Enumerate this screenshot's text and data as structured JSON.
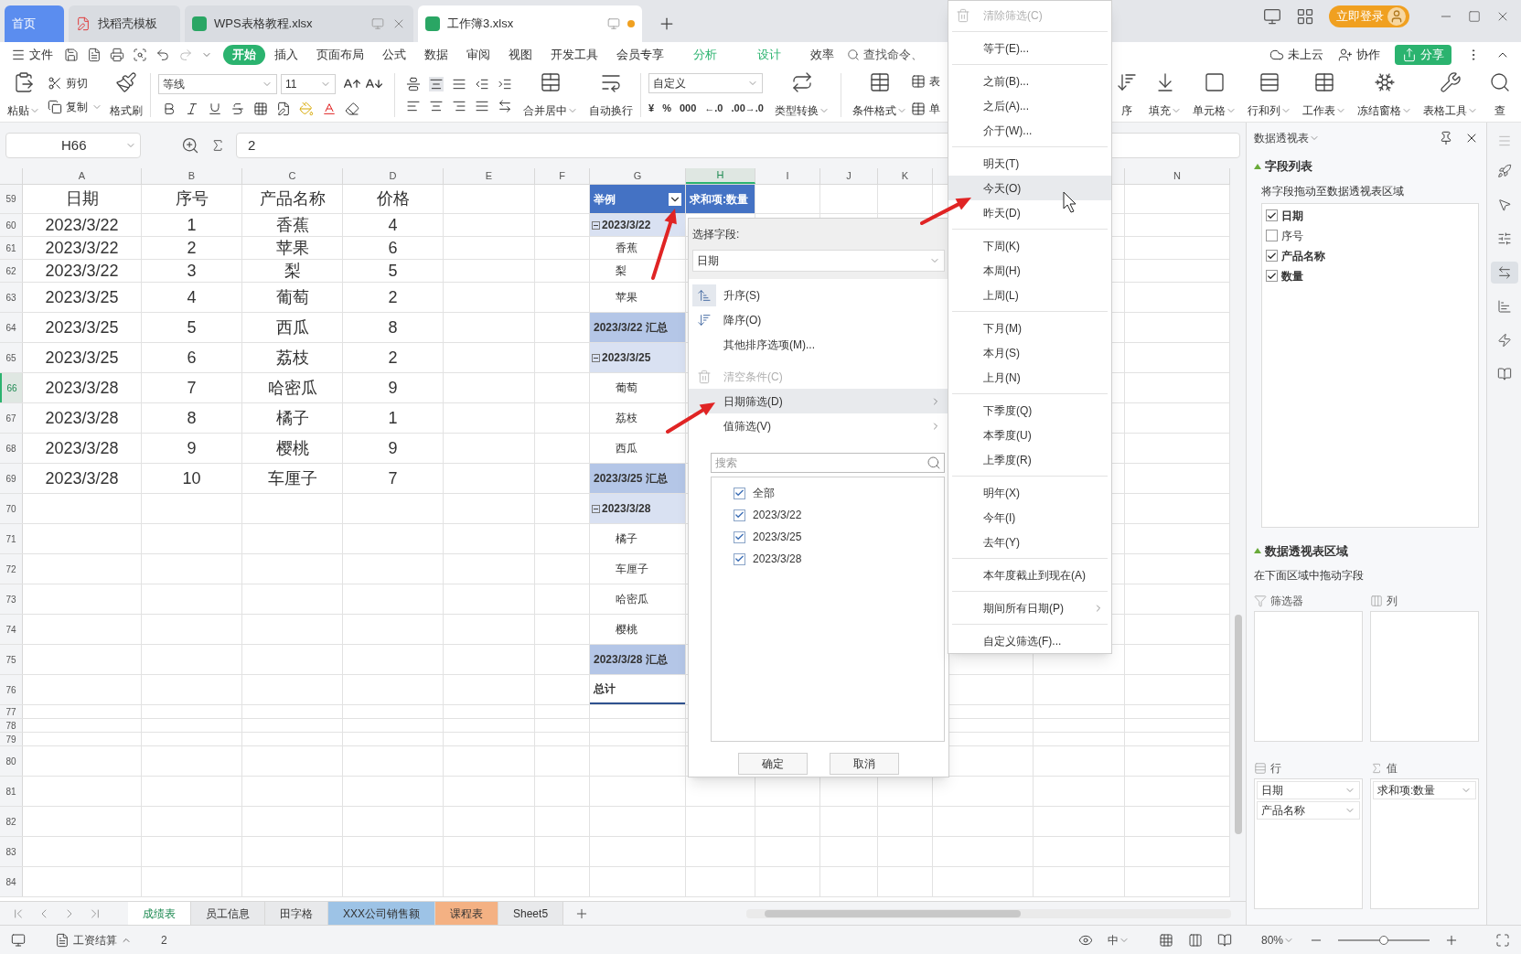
{
  "title_tabs": [
    {
      "label": "首页",
      "kind": "home",
      "selected": false,
      "unsaved": false
    },
    {
      "label": "找稻壳模板",
      "kind": "template",
      "selected": false,
      "unsaved": false
    },
    {
      "label": "WPS表格教程.xlsx",
      "kind": "sheet",
      "selected": false,
      "unsaved": false
    },
    {
      "label": "工作簿3.xlsx",
      "kind": "sheet",
      "selected": true,
      "unsaved": true
    }
  ],
  "account": {
    "login": "立即登录"
  },
  "menu": {
    "file": "文件",
    "tabs": [
      {
        "label": "开始",
        "kind": "normal",
        "selected": true
      },
      {
        "label": "插入",
        "kind": "normal",
        "selected": false
      },
      {
        "label": "页面布局",
        "kind": "normal",
        "selected": false
      },
      {
        "label": "公式",
        "kind": "normal",
        "selected": false
      },
      {
        "label": "数据",
        "kind": "normal",
        "selected": false
      },
      {
        "label": "审阅",
        "kind": "normal",
        "selected": false
      },
      {
        "label": "视图",
        "kind": "normal",
        "selected": false
      },
      {
        "label": "开发工具",
        "kind": "normal",
        "selected": false
      },
      {
        "label": "会员专享",
        "kind": "normal",
        "selected": false
      },
      {
        "label": "分析",
        "kind": "context",
        "selected": false
      },
      {
        "label": "设计",
        "kind": "context",
        "selected": false
      },
      {
        "label": "效率",
        "kind": "normal",
        "selected": false
      }
    ],
    "search": "查找命令、",
    "cloud": "未上云",
    "collab": "协作",
    "share": "分享"
  },
  "ribbon": {
    "paste": "粘贴",
    "cut": "剪切",
    "copy": "复制",
    "format_painter": "格式刷",
    "font_name": "等线",
    "font_size": "11",
    "merge": "合并居中",
    "wrap": "自动换行",
    "number_format": "自定义",
    "number_symbols": [
      "¥",
      "%",
      "000",
      "←.0",
      ".00→.0"
    ],
    "convert": "类型转换",
    "conditional": "条件格式",
    "cut_labels": [
      "表",
      "单"
    ],
    "right_tools": [
      {
        "label": "序",
        "kind": "sort"
      },
      {
        "label": "填充",
        "kind": "fill"
      },
      {
        "label": "单元格",
        "kind": "cell"
      },
      {
        "label": "行和列",
        "kind": "rowcol"
      },
      {
        "label": "工作表",
        "kind": "sheet"
      },
      {
        "label": "冻结窗格",
        "kind": "freeze"
      },
      {
        "label": "表格工具",
        "kind": "tools"
      },
      {
        "label": "查",
        "kind": "find"
      }
    ]
  },
  "formula_bar": {
    "cell": "H66",
    "value": "2"
  },
  "sheet": {
    "columns": [
      {
        "label": "A",
        "selected": false
      },
      {
        "label": "B",
        "selected": false
      },
      {
        "label": "C",
        "selected": false
      },
      {
        "label": "D",
        "selected": false
      },
      {
        "label": "E",
        "selected": false
      },
      {
        "label": "F",
        "selected": false
      },
      {
        "label": "G",
        "selected": false
      },
      {
        "label": "H",
        "selected": true
      },
      {
        "label": "I",
        "selected": false
      },
      {
        "label": "J",
        "selected": false
      },
      {
        "label": "K",
        "selected": false
      },
      {
        "label": "N",
        "selected": false
      }
    ],
    "rows": [
      {
        "number": "59",
        "selected": false,
        "cells": [
          "日期",
          "序号",
          "产品名称",
          "价格"
        ]
      },
      {
        "number": "60",
        "selected": false,
        "cells": [
          "2023/3/22",
          "1",
          "香蕉",
          "4"
        ]
      },
      {
        "number": "61",
        "selected": false,
        "cells": [
          "2023/3/22",
          "2",
          "苹果",
          "6"
        ]
      },
      {
        "number": "62",
        "selected": false,
        "cells": [
          "2023/3/22",
          "3",
          "梨",
          "5"
        ]
      },
      {
        "number": "63",
        "selected": false,
        "cells": [
          "2023/3/25",
          "4",
          "葡萄",
          "2"
        ]
      },
      {
        "number": "64",
        "selected": false,
        "cells": [
          "2023/3/25",
          "5",
          "西瓜",
          "8"
        ]
      },
      {
        "number": "65",
        "selected": false,
        "cells": [
          "2023/3/25",
          "6",
          "荔枝",
          "2"
        ]
      },
      {
        "number": "66",
        "selected": true,
        "cells": [
          "2023/3/28",
          "7",
          "哈密瓜",
          "9"
        ]
      },
      {
        "number": "67",
        "selected": false,
        "cells": [
          "2023/3/28",
          "8",
          "橘子",
          "1"
        ]
      },
      {
        "number": "68",
        "selected": false,
        "cells": [
          "2023/3/28",
          "9",
          "樱桃",
          "9"
        ]
      },
      {
        "number": "69",
        "selected": false,
        "cells": [
          "2023/3/28",
          "10",
          "车厘子",
          "7"
        ]
      },
      {
        "number": "70",
        "selected": false
      },
      {
        "number": "71",
        "selected": false
      },
      {
        "number": "72",
        "selected": false
      },
      {
        "number": "73",
        "selected": false
      },
      {
        "number": "74",
        "selected": false
      },
      {
        "number": "75",
        "selected": false
      },
      {
        "number": "76",
        "selected": false
      },
      {
        "number": "77",
        "selected": false
      },
      {
        "number": "78",
        "selected": false
      },
      {
        "number": "79",
        "selected": false
      },
      {
        "number": "80",
        "selected": false
      },
      {
        "number": "81",
        "selected": false
      },
      {
        "number": "82",
        "selected": false
      },
      {
        "number": "83",
        "selected": false
      },
      {
        "number": "84",
        "selected": false
      }
    ]
  },
  "pivot": {
    "value_header": "求和项:数量",
    "rows": [
      {
        "label": "举例",
        "kind": "header"
      },
      {
        "label": "2023/3/22",
        "kind": "group"
      },
      {
        "label": "香蕉",
        "kind": "item"
      },
      {
        "label": "梨",
        "kind": "item"
      },
      {
        "label": "苹果",
        "kind": "item"
      },
      {
        "label": "2023/3/22 汇总",
        "kind": "subtotal"
      },
      {
        "label": "2023/3/25",
        "kind": "group"
      },
      {
        "label": "葡萄",
        "kind": "item"
      },
      {
        "label": "荔枝",
        "kind": "item"
      },
      {
        "label": "西瓜",
        "kind": "item"
      },
      {
        "label": "2023/3/25 汇总",
        "kind": "subtotal"
      },
      {
        "label": "2023/3/28",
        "kind": "group"
      },
      {
        "label": "橘子",
        "kind": "item"
      },
      {
        "label": "车厘子",
        "kind": "item"
      },
      {
        "label": "哈密瓜",
        "kind": "item"
      },
      {
        "label": "樱桃",
        "kind": "item"
      },
      {
        "label": "2023/3/28 汇总",
        "kind": "subtotal"
      },
      {
        "label": "总计",
        "kind": "total"
      }
    ]
  },
  "filter_popup": {
    "field_label": "选择字段:",
    "field": "日期",
    "sort": [
      {
        "label": "升序(S)",
        "kind": "asc"
      },
      {
        "label": "降序(O)",
        "kind": "desc"
      },
      {
        "label": "其他排序选项(M)...",
        "kind": "more"
      }
    ],
    "actions": [
      {
        "label": "清空条件(C)",
        "kind": "clear",
        "disabled": true,
        "selected": false,
        "submenu": false
      },
      {
        "label": "日期筛选(D)",
        "kind": "date",
        "disabled": false,
        "selected": true,
        "submenu": true
      },
      {
        "label": "值筛选(V)",
        "kind": "value",
        "disabled": false,
        "selected": false,
        "submenu": true
      }
    ],
    "search_placeholder": "搜索",
    "values": [
      {
        "label": "全部",
        "checked": true
      },
      {
        "label": "2023/3/22",
        "checked": true
      },
      {
        "label": "2023/3/25",
        "checked": true
      },
      {
        "label": "2023/3/28",
        "checked": true
      }
    ],
    "ok": "确定",
    "cancel": "取消"
  },
  "date_submenu": [
    [
      {
        "label": "清除筛选(C)",
        "kind": "clear",
        "selected": false,
        "disabled": true,
        "submenu": false
      }
    ],
    [
      {
        "label": "等于(E)...",
        "kind": "option",
        "selected": false,
        "disabled": false,
        "submenu": false
      }
    ],
    [
      {
        "label": "之前(B)...",
        "kind": "option",
        "selected": false,
        "disabled": false,
        "submenu": false
      },
      {
        "label": "之后(A)...",
        "kind": "option",
        "selected": false,
        "disabled": false,
        "submenu": false
      },
      {
        "label": "介于(W)...",
        "kind": "option",
        "selected": false,
        "disabled": false,
        "submenu": false
      }
    ],
    [
      {
        "label": "明天(T)",
        "kind": "option",
        "selected": false,
        "disabled": false,
        "submenu": false
      },
      {
        "label": "今天(O)",
        "kind": "option",
        "selected": true,
        "disabled": false,
        "submenu": false
      },
      {
        "label": "昨天(D)",
        "kind": "option",
        "selected": false,
        "disabled": false,
        "submenu": false
      }
    ],
    [
      {
        "label": "下周(K)",
        "kind": "option",
        "selected": false,
        "disabled": false,
        "submenu": false
      },
      {
        "label": "本周(H)",
        "kind": "option",
        "selected": false,
        "disabled": false,
        "submenu": false
      },
      {
        "label": "上周(L)",
        "kind": "option",
        "selected": false,
        "disabled": false,
        "submenu": false
      }
    ],
    [
      {
        "label": "下月(M)",
        "kind": "option",
        "selected": false,
        "disabled": false,
        "submenu": false
      },
      {
        "label": "本月(S)",
        "kind": "option",
        "selected": false,
        "disabled": false,
        "submenu": false
      },
      {
        "label": "上月(N)",
        "kind": "option",
        "selected": false,
        "disabled": false,
        "submenu": false
      }
    ],
    [
      {
        "label": "下季度(Q)",
        "kind": "option",
        "selected": false,
        "disabled": false,
        "submenu": false
      },
      {
        "label": "本季度(U)",
        "kind": "option",
        "selected": false,
        "disabled": false,
        "submenu": false
      },
      {
        "label": "上季度(R)",
        "kind": "option",
        "selected": false,
        "disabled": false,
        "submenu": false
      }
    ],
    [
      {
        "label": "明年(X)",
        "kind": "option",
        "selected": false,
        "disabled": false,
        "submenu": false
      },
      {
        "label": "今年(I)",
        "kind": "option",
        "selected": false,
        "disabled": false,
        "submenu": false
      },
      {
        "label": "去年(Y)",
        "kind": "option",
        "selected": false,
        "disabled": false,
        "submenu": false
      }
    ],
    [
      {
        "label": "本年度截止到现在(A)",
        "kind": "option",
        "selected": false,
        "disabled": false,
        "submenu": false
      }
    ],
    [
      {
        "label": "期间所有日期(P)",
        "kind": "option",
        "selected": false,
        "disabled": false,
        "submenu": true
      }
    ],
    [
      {
        "label": "自定义筛选(F)...",
        "kind": "option",
        "selected": false,
        "disabled": false,
        "submenu": false
      }
    ]
  ],
  "pivot_panel": {
    "title": "数据透视表",
    "field_section": "字段列表",
    "field_hint": "将字段拖动至数据透视表区域",
    "fields": [
      {
        "label": "日期",
        "checked": true
      },
      {
        "label": "序号",
        "checked": false
      },
      {
        "label": "产品名称",
        "checked": true
      },
      {
        "label": "数量",
        "checked": true
      }
    ],
    "area_section": "数据透视表区域",
    "area_hint": "在下面区域中拖动字段",
    "areas": [
      {
        "label": "筛选器",
        "kind": "filter"
      },
      {
        "label": "列",
        "kind": "column"
      },
      {
        "label": "行",
        "kind": "row",
        "items": [
          "日期",
          "产品名称"
        ]
      },
      {
        "label": "值",
        "kind": "value",
        "items": [
          "求和项:数量"
        ]
      }
    ]
  },
  "side_icons": [
    {
      "kind": "rocket",
      "selected": false
    },
    {
      "kind": "pointer",
      "selected": false
    },
    {
      "kind": "sliders",
      "selected": false
    },
    {
      "kind": "pivot",
      "selected": true
    },
    {
      "kind": "chart",
      "selected": false
    },
    {
      "kind": "bolt",
      "selected": false
    },
    {
      "kind": "book",
      "selected": false
    }
  ],
  "sheet_tabs": [
    {
      "label": "成绩表",
      "selected": true
    },
    {
      "label": "员工信息",
      "selected": false
    },
    {
      "label": "田字格",
      "selected": false
    },
    {
      "label": "XXX公司销售额",
      "selected": false,
      "color": "#9dc3e6"
    },
    {
      "label": "课程表",
      "selected": false,
      "color": "#f4b183"
    },
    {
      "label": "Sheet5",
      "selected": false
    }
  ],
  "status_bar": {
    "macro": "工资结算",
    "value": "2",
    "ime": "中",
    "zoom": "80%",
    "level": 0.5
  }
}
